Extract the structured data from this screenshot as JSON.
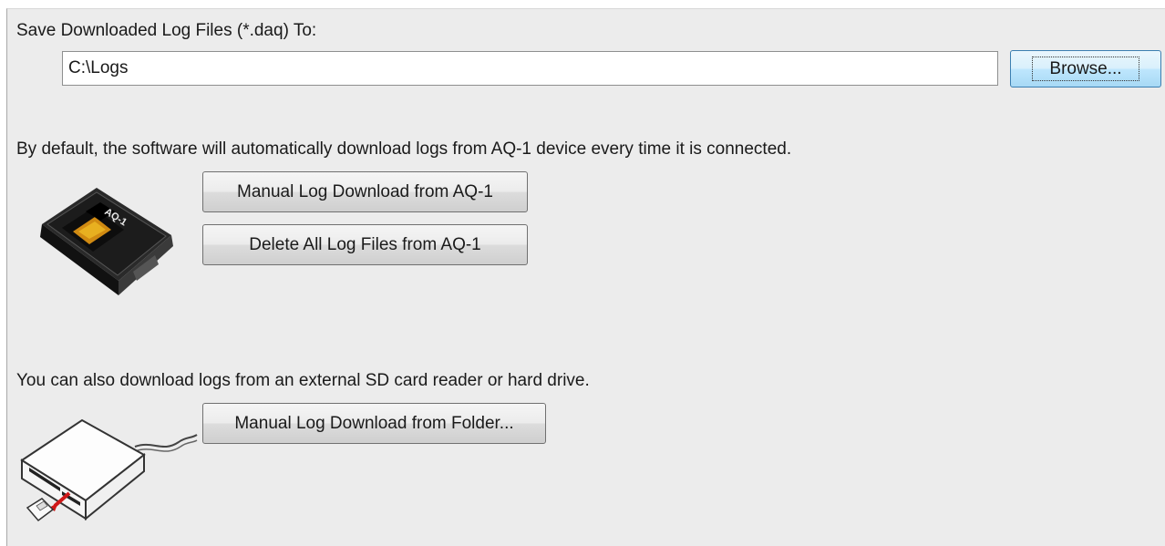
{
  "save_section": {
    "label": "Save Downloaded Log Files (*.daq) To:",
    "path_value": "C:\\Logs",
    "browse_label": "Browse..."
  },
  "aq1_section": {
    "description": "By default, the software will automatically download logs from AQ-1 device every time it is connected.",
    "device_label": "AQ-1",
    "manual_download_label": "Manual Log Download from AQ-1",
    "delete_label": "Delete All Log Files from AQ-1"
  },
  "external_section": {
    "description": "You can also download logs from an external SD card reader or hard drive.",
    "folder_download_label": "Manual Log Download from Folder..."
  }
}
